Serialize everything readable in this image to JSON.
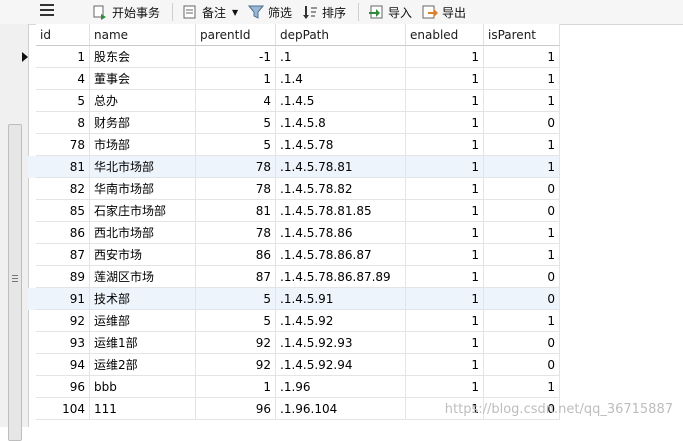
{
  "toolbar": {
    "begin_tx": "开始事务",
    "note": "备注",
    "filter": "筛选",
    "sort": "排序",
    "import": "导入",
    "export": "导出"
  },
  "columns": [
    "id",
    "name",
    "parentId",
    "depPath",
    "enabled",
    "isParent"
  ],
  "rows": [
    {
      "id": "1",
      "name": "股东会",
      "parentId": "-1",
      "depPath": ".1",
      "enabled": "1",
      "isParent": "1"
    },
    {
      "id": "4",
      "name": "董事会",
      "parentId": "1",
      "depPath": ".1.4",
      "enabled": "1",
      "isParent": "1"
    },
    {
      "id": "5",
      "name": "总办",
      "parentId": "4",
      "depPath": ".1.4.5",
      "enabled": "1",
      "isParent": "1"
    },
    {
      "id": "8",
      "name": "财务部",
      "parentId": "5",
      "depPath": ".1.4.5.8",
      "enabled": "1",
      "isParent": "0"
    },
    {
      "id": "78",
      "name": "市场部",
      "parentId": "5",
      "depPath": ".1.4.5.78",
      "enabled": "1",
      "isParent": "1"
    },
    {
      "id": "81",
      "name": "华北市场部",
      "parentId": "78",
      "depPath": ".1.4.5.78.81",
      "enabled": "1",
      "isParent": "1"
    },
    {
      "id": "82",
      "name": "华南市场部",
      "parentId": "78",
      "depPath": ".1.4.5.78.82",
      "enabled": "1",
      "isParent": "0"
    },
    {
      "id": "85",
      "name": "石家庄市场部",
      "parentId": "81",
      "depPath": ".1.4.5.78.81.85",
      "enabled": "1",
      "isParent": "0"
    },
    {
      "id": "86",
      "name": "西北市场部",
      "parentId": "78",
      "depPath": ".1.4.5.78.86",
      "enabled": "1",
      "isParent": "1"
    },
    {
      "id": "87",
      "name": "西安市场",
      "parentId": "86",
      "depPath": ".1.4.5.78.86.87",
      "enabled": "1",
      "isParent": "1"
    },
    {
      "id": "89",
      "name": "莲湖区市场",
      "parentId": "87",
      "depPath": ".1.4.5.78.86.87.89",
      "enabled": "1",
      "isParent": "0"
    },
    {
      "id": "91",
      "name": "技术部",
      "parentId": "5",
      "depPath": ".1.4.5.91",
      "enabled": "1",
      "isParent": "0"
    },
    {
      "id": "92",
      "name": "运维部",
      "parentId": "5",
      "depPath": ".1.4.5.92",
      "enabled": "1",
      "isParent": "1"
    },
    {
      "id": "93",
      "name": "运维1部",
      "parentId": "92",
      "depPath": ".1.4.5.92.93",
      "enabled": "1",
      "isParent": "0"
    },
    {
      "id": "94",
      "name": "运维2部",
      "parentId": "92",
      "depPath": ".1.4.5.92.94",
      "enabled": "1",
      "isParent": "0"
    },
    {
      "id": "96",
      "name": "bbb",
      "parentId": "1",
      "depPath": ".1.96",
      "enabled": "1",
      "isParent": "1"
    },
    {
      "id": "104",
      "name": "111",
      "parentId": "96",
      "depPath": ".1.96.104",
      "enabled": "1",
      "isParent": "0"
    }
  ],
  "watermark": "https://blog.csdn.net/qq_36715887",
  "colors": {
    "selected_row": "#eef4fb"
  }
}
